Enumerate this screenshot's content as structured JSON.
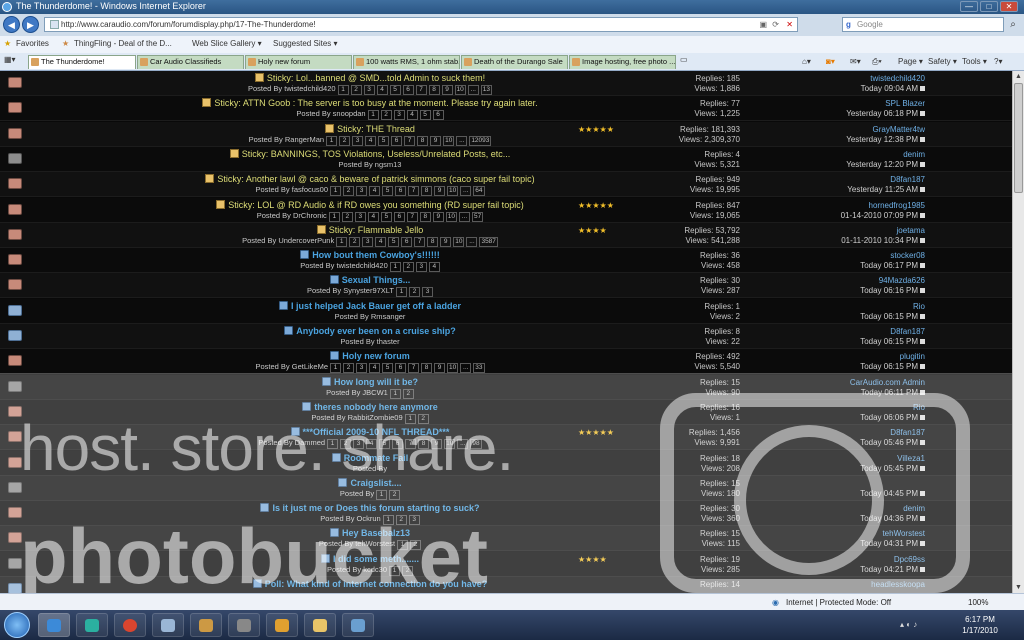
{
  "window": {
    "title": "The Thunderdome! - Windows Internet Explorer",
    "min": "—",
    "max": "□",
    "close": "✕"
  },
  "address": {
    "url": "http://www.caraudio.com/forum/forumdisplay.php/17-The-Thunderdome!",
    "search_placeholder": "Google",
    "back": "◀",
    "forward": "▶"
  },
  "favorites": {
    "label": "Favorites",
    "items": [
      "ThingFling - Deal of the D...",
      "Web Slice Gallery ▾",
      "Suggested Sites ▾"
    ]
  },
  "tabs": [
    {
      "label": "The Thunderdome!",
      "active": true
    },
    {
      "label": "Car Audio Classifieds",
      "active": false
    },
    {
      "label": "Holy new forum",
      "active": false
    },
    {
      "label": "100 watts RMS, 1 ohm stab...",
      "active": false
    },
    {
      "label": "Death of the Durango Sale",
      "active": false
    },
    {
      "label": "Image hosting, free photo ...",
      "active": false
    }
  ],
  "toolbar": {
    "page": "Page ▾",
    "safety": "Safety ▾",
    "tools": "Tools ▾",
    "help": "?▾"
  },
  "threads": [
    {
      "sticky": true,
      "title": "Sticky: Lol...banned @ SMD...told Admin to suck them!",
      "posted_by": "Posted By twistedchild420",
      "pages": [
        "1",
        "2",
        "3",
        "4",
        "5",
        "6",
        "7",
        "8",
        "9",
        "10",
        "...",
        "13"
      ],
      "replies": "Replies: 185",
      "views": "Views: 1,886",
      "last_user": "twistedchild420",
      "last_time": "Today 09:04 AM",
      "stars": "",
      "icon": "red"
    },
    {
      "sticky": true,
      "title": "Sticky: ATTN Goob : The server is too busy at the moment. Please try again later.",
      "posted_by": "Posted By snoopdan",
      "pages": [
        "1",
        "2",
        "3",
        "4",
        "5",
        "6"
      ],
      "replies": "Replies: 77",
      "views": "Views: 1,225",
      "last_user": "SPL Blazer",
      "last_time": "Yesterday 06:18 PM",
      "stars": "",
      "icon": "red"
    },
    {
      "sticky": true,
      "title": "Sticky: THE Thread",
      "posted_by": "Posted By RangerMan",
      "pages": [
        "1",
        "2",
        "3",
        "4",
        "5",
        "6",
        "7",
        "8",
        "9",
        "10",
        "...",
        "12093"
      ],
      "replies": "Replies: 181,393",
      "views": "Views: 2,309,370",
      "last_user": "GrayMatter4tw",
      "last_time": "Yesterday 12:38 PM",
      "stars": "★★★★★",
      "icon": "red"
    },
    {
      "sticky": true,
      "title": "Sticky: BANNINGS, TOS Violations, Useless/Unrelated Posts, etc...",
      "posted_by": "Posted By ngsm13",
      "pages": [],
      "replies": "Replies: 4",
      "views": "Views: 5,321",
      "last_user": "denim",
      "last_time": "Yesterday 12:20 PM",
      "stars": "",
      "icon": "gray"
    },
    {
      "sticky": true,
      "title": "Sticky: Another lawl @ caco & beware of patrick simmons (caco super fail topic)",
      "posted_by": "Posted By fasfocus00",
      "pages": [
        "1",
        "2",
        "3",
        "4",
        "5",
        "6",
        "7",
        "8",
        "9",
        "10",
        "...",
        "64"
      ],
      "replies": "Replies: 949",
      "views": "Views: 19,995",
      "last_user": "D8fan187",
      "last_time": "Yesterday 11:25 AM",
      "stars": "",
      "icon": "red"
    },
    {
      "sticky": true,
      "title": "Sticky: LOL @ RD Audio & if RD owes you something (RD super fail topic)",
      "posted_by": "Posted By DrChronic",
      "pages": [
        "1",
        "2",
        "3",
        "4",
        "5",
        "6",
        "7",
        "8",
        "9",
        "10",
        "...",
        "57"
      ],
      "replies": "Replies: 847",
      "views": "Views: 19,065",
      "last_user": "hornedfrog1985",
      "last_time": "01-14-2010 07:09 PM",
      "stars": "★★★★★",
      "icon": "red"
    },
    {
      "sticky": true,
      "title": "Sticky: Flammable Jello",
      "posted_by": "Posted By UndercoverPunk",
      "pages": [
        "1",
        "2",
        "3",
        "4",
        "5",
        "6",
        "7",
        "8",
        "9",
        "10",
        "...",
        "3587"
      ],
      "replies": "Replies: 53,792",
      "views": "Views: 541,288",
      "last_user": "joetama",
      "last_time": "01-11-2010 10:34 PM",
      "stars": "★★★★",
      "icon": "red"
    },
    {
      "sticky": false,
      "title": "How bout them Cowboy's!!!!!!",
      "posted_by": "Posted By twistedchild420",
      "pages": [
        "1",
        "2",
        "3",
        "4"
      ],
      "replies": "Replies: 36",
      "views": "Views: 458",
      "last_user": "stocker08",
      "last_time": "Today 06:17 PM",
      "stars": "",
      "icon": "red"
    },
    {
      "sticky": false,
      "title": "Sexual Things...",
      "posted_by": "Posted By Synyster97XLT",
      "pages": [
        "1",
        "2",
        "3"
      ],
      "replies": "Replies: 30",
      "views": "Views: 287",
      "last_user": "94Mazda626",
      "last_time": "Today 06:16 PM",
      "stars": "",
      "icon": "red"
    },
    {
      "sticky": false,
      "title": "I just helped Jack Bauer get off a ladder",
      "posted_by": "Posted By Rmsanger",
      "pages": [],
      "replies": "Replies: 1",
      "views": "Views: 2",
      "last_user": "Rio",
      "last_time": "Today 06:15 PM",
      "stars": "",
      "icon": "blue"
    },
    {
      "sticky": false,
      "title": "Anybody ever been on a cruise ship?",
      "posted_by": "Posted By thaster",
      "pages": [],
      "replies": "Replies: 8",
      "views": "Views: 22",
      "last_user": "D8fan187",
      "last_time": "Today 06:15 PM",
      "stars": "",
      "icon": "blue"
    },
    {
      "sticky": false,
      "title": "Holy new forum",
      "posted_by": "Posted By GetLikeMe",
      "pages": [
        "1",
        "2",
        "3",
        "4",
        "5",
        "6",
        "7",
        "8",
        "9",
        "10",
        "...",
        "33"
      ],
      "replies": "Replies: 492",
      "views": "Views: 5,540",
      "last_user": "plugitin",
      "last_time": "Today 06:15 PM",
      "stars": "",
      "icon": "red"
    },
    {
      "sticky": false,
      "title": "How long will it be?",
      "posted_by": "Posted By JBCW1",
      "pages": [
        "1",
        "2"
      ],
      "replies": "Replies: 15",
      "views": "Views: 90",
      "last_user": "CarAudio.com Admin",
      "last_time": "Today 06:11 PM",
      "stars": "",
      "icon": "gray"
    },
    {
      "sticky": false,
      "title": "theres nobody here anymore",
      "posted_by": "Posted By RabbitZombie09",
      "pages": [
        "1",
        "2"
      ],
      "replies": "Replies: 16",
      "views": "Views: 1",
      "last_user": "Rio",
      "last_time": "Today 06:06 PM",
      "stars": "",
      "icon": "red"
    },
    {
      "sticky": false,
      "title": "***Official 2009-10 NFL THREAD***",
      "posted_by": "Posted By Dammed",
      "pages": [
        "1",
        "2",
        "3",
        "4",
        "5",
        "6",
        "7",
        "8",
        "9",
        "10",
        "...",
        "98"
      ],
      "replies": "Replies: 1,456",
      "views": "Views: 9,991",
      "last_user": "D8fan187",
      "last_time": "Today 05:46 PM",
      "stars": "★★★★★",
      "icon": "red"
    },
    {
      "sticky": false,
      "title": "Roommate Fail",
      "posted_by": "Posted By",
      "pages": [],
      "replies": "Replies: 18",
      "views": "Views: 208",
      "last_user": "Villeza1",
      "last_time": "Today 05:45 PM",
      "stars": "",
      "icon": "red"
    },
    {
      "sticky": false,
      "title": "Craigslist....",
      "posted_by": "Posted By",
      "pages": [
        "1",
        "2"
      ],
      "replies": "Replies: 15",
      "views": "Views: 180",
      "last_user": "",
      "last_time": "Today 04:45 PM",
      "stars": "",
      "icon": "gray"
    },
    {
      "sticky": false,
      "title": "Is it just me or Does this forum starting to suck?",
      "posted_by": "Posted By Ockrun",
      "pages": [
        "1",
        "2",
        "3"
      ],
      "replies": "Replies: 30",
      "views": "Views: 360",
      "last_user": "denim",
      "last_time": "Today 04:36 PM",
      "stars": "",
      "icon": "red"
    },
    {
      "sticky": false,
      "title": "Hey Basebalz13",
      "posted_by": "Posted By tehWorstest",
      "pages": [
        "1",
        "2"
      ],
      "replies": "Replies: 15",
      "views": "Views: 115",
      "last_user": "tehWorstest",
      "last_time": "Today 04:31 PM",
      "stars": "",
      "icon": "red"
    },
    {
      "sticky": false,
      "title": "I did some meth.......",
      "posted_by": "Posted By kcdc30",
      "pages": [
        "1",
        "2"
      ],
      "replies": "Replies: 19",
      "views": "Views: 285",
      "last_user": "Dpc69ss",
      "last_time": "Today 04:21 PM",
      "stars": "★★★★",
      "icon": "gray"
    },
    {
      "sticky": false,
      "title": "Poll: What kind of internet connection do you have?",
      "posted_by": "",
      "pages": [],
      "replies": "Replies: 14",
      "views": "",
      "last_user": "headlesskoopa",
      "last_time": "",
      "stars": "",
      "icon": "blue"
    }
  ],
  "watermark": {
    "line1": "host. store. share.",
    "line2": "photobucket"
  },
  "status": {
    "zone": "Internet | Protected Mode: Off",
    "zoom": "100%"
  },
  "clock": {
    "time": "6:17 PM",
    "date": "1/17/2010"
  }
}
